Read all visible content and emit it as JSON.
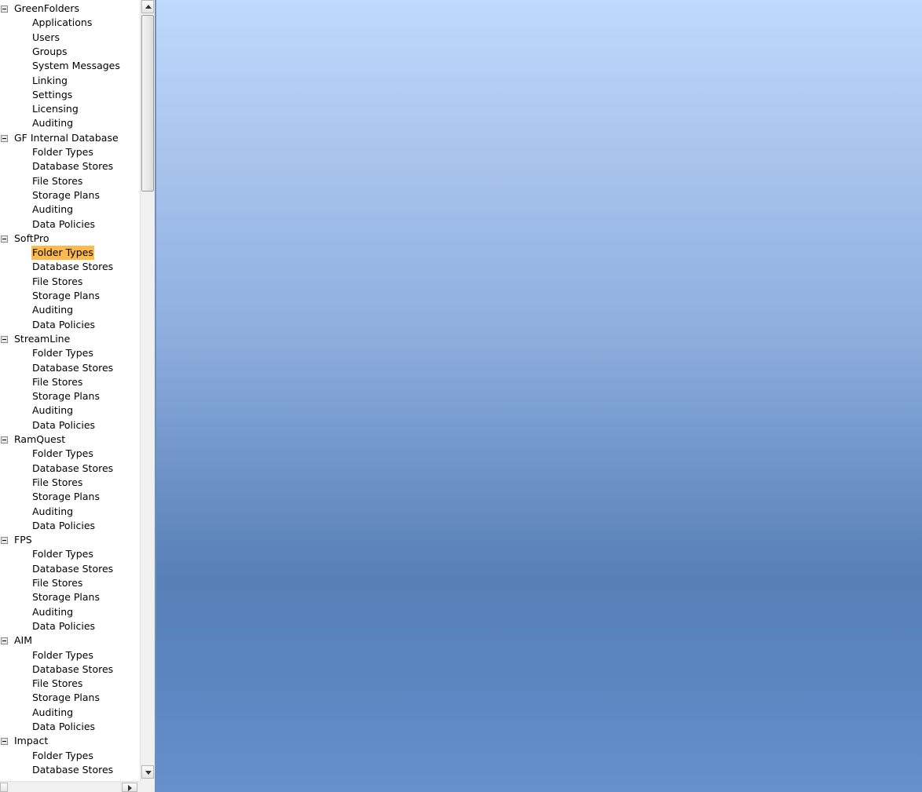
{
  "tree": {
    "selected": {
      "group": 2,
      "item": 0
    },
    "groups": [
      {
        "label": "GreenFolders",
        "expanded": true,
        "children": [
          "Applications",
          "Users",
          "Groups",
          "System Messages",
          "Linking",
          "Settings",
          "Licensing",
          "Auditing"
        ]
      },
      {
        "label": "GF Internal Database",
        "expanded": true,
        "children": [
          "Folder Types",
          "Database Stores",
          "File Stores",
          "Storage Plans",
          "Auditing",
          "Data Policies"
        ]
      },
      {
        "label": "SoftPro",
        "expanded": true,
        "children": [
          "Folder Types",
          "Database Stores",
          "File Stores",
          "Storage Plans",
          "Auditing",
          "Data Policies"
        ]
      },
      {
        "label": "StreamLine",
        "expanded": true,
        "children": [
          "Folder Types",
          "Database Stores",
          "File Stores",
          "Storage Plans",
          "Auditing",
          "Data Policies"
        ]
      },
      {
        "label": "RamQuest",
        "expanded": true,
        "children": [
          "Folder Types",
          "Database Stores",
          "File Stores",
          "Storage Plans",
          "Auditing",
          "Data Policies"
        ]
      },
      {
        "label": "FPS",
        "expanded": true,
        "children": [
          "Folder Types",
          "Database Stores",
          "File Stores",
          "Storage Plans",
          "Auditing",
          "Data Policies"
        ]
      },
      {
        "label": "AIM",
        "expanded": true,
        "children": [
          "Folder Types",
          "Database Stores",
          "File Stores",
          "Storage Plans",
          "Auditing",
          "Data Policies"
        ]
      },
      {
        "label": "Impact",
        "expanded": true,
        "children": [
          "Folder Types",
          "Database Stores"
        ]
      }
    ]
  },
  "colors": {
    "selection_highlight": "#ffba4e",
    "content_gradient_top": "#bed9fd",
    "content_gradient_mid": "#5780b6",
    "content_gradient_bottom": "#6690cc"
  },
  "icons": {
    "collapse": "minus-box-icon",
    "scroll_up": "arrow-up-icon",
    "scroll_down": "arrow-down-icon",
    "scroll_right": "arrow-right-icon"
  }
}
